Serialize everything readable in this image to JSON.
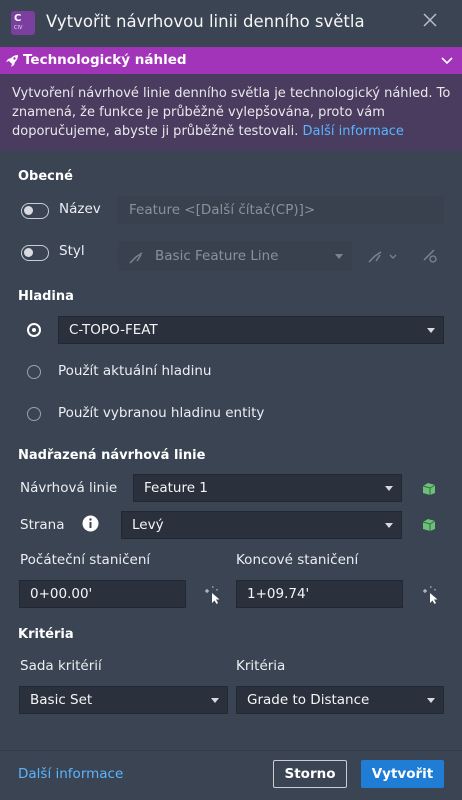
{
  "window": {
    "title": "Vytvořit návrhovou linii denního světla",
    "app_icon_letter": "C",
    "app_icon_sub": "CIV"
  },
  "preview": {
    "title": "Technologický náhled",
    "text": "Vytvoření návrhové linie denního světla je technologický náhled. To znamená, že funkce je průběžně vylepšována, proto vám doporučujeme, abyste ji průběžně testovali.",
    "link": "Další informace"
  },
  "general": {
    "header": "Obecné",
    "name_label": "Název",
    "name_placeholder": "Feature <[Další čítač(CP)]>",
    "style_label": "Styl",
    "style_value": "Basic Feature Line"
  },
  "layer": {
    "header": "Hladina",
    "selected_value": "C-TOPO-FEAT",
    "option_current": "Použít aktuální hladinu",
    "option_entity": "Použít vybranou hladinu entity"
  },
  "parent": {
    "header": "Nadřazená návrhová linie",
    "featureline_label": "Návrhová linie",
    "featureline_value": "Feature 1",
    "side_label": "Strana",
    "side_value": "Levý",
    "start_label": "Počáteční staničení",
    "start_value": "0+00.00'",
    "end_label": "Koncové staničení",
    "end_value": "1+09.74'"
  },
  "criteria": {
    "header": "Kritéria",
    "set_label": "Sada kritérií",
    "set_value": "Basic Set",
    "criteria_label": "Kritéria",
    "criteria_value": "Grade to Distance"
  },
  "footer": {
    "more_info": "Další informace",
    "cancel": "Storno",
    "create": "Vytvořit"
  },
  "colors": {
    "preview_banner": "#a234b9",
    "preview_body": "#4a3c5e",
    "primary_button": "#1f7dd6",
    "link": "#59b5ff",
    "dialog_bg": "#3b4453"
  }
}
